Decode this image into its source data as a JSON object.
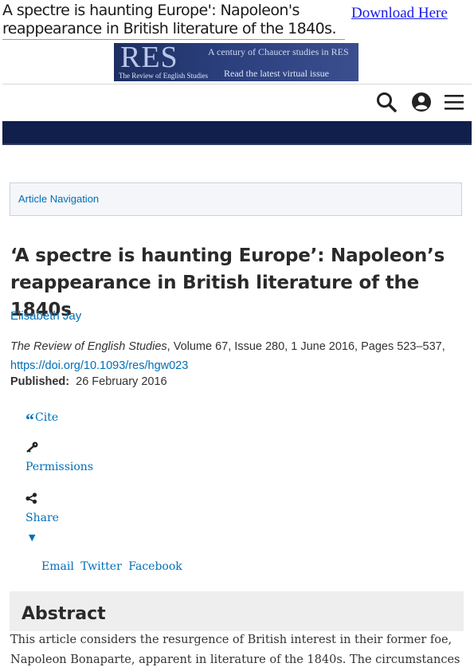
{
  "top": {
    "doc_title": "A spectre is haunting Europe': Napoleon's reappearance in British literature of the 1840s.",
    "download_label": "Download Here"
  },
  "banner": {
    "logo": "RES",
    "logo_sub": "The Review of English Studies",
    "line1": "A century of Chaucer studies in RES",
    "line2": "Read the latest virtual issue"
  },
  "toolbar": {
    "icons": [
      "search-icon",
      "account-icon",
      "menu-icon"
    ],
    "nav_color": "#101f4b"
  },
  "article_nav": {
    "label": "Article Navigation"
  },
  "article": {
    "title": "‘A spectre is haunting Europe’: Napoleon’s reappearance in British literature of the 1840s",
    "author": "Elisabeth Jay",
    "journal": "The Review of English Studies",
    "citation_rest": ", Volume 67, Issue 280, 1 June 2016, Pages 523–537,",
    "doi": "https://doi.org/10.1093/res/hgw023",
    "published_label": "Published:",
    "published_date": "26 February 2016"
  },
  "tools": {
    "cite_label": "Cite",
    "permissions_label": "Permissions",
    "share_label": "Share",
    "caret": "▼",
    "share_links": [
      "Email",
      "Twitter",
      "Facebook"
    ]
  },
  "abstract": {
    "heading": "Abstract",
    "text": "This article considers the resurgence of British interest in their former foe, Napoleon Bonaparte, apparent in literature of the 1840s. The circumstances"
  },
  "colors": {
    "link": "#006fb7",
    "download": "#1a1aee",
    "banner": "#1d2f62"
  }
}
